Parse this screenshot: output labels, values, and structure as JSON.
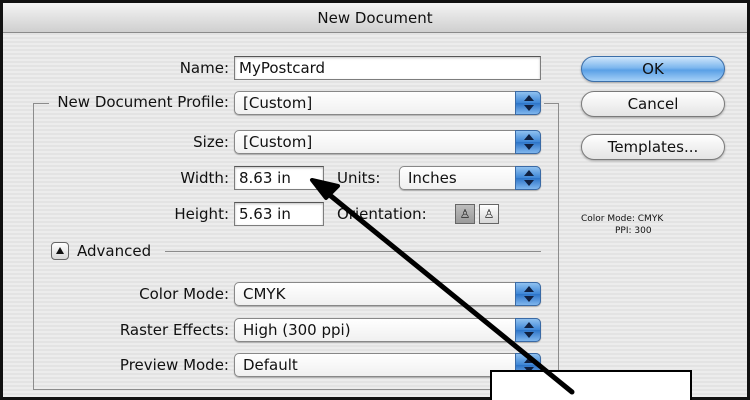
{
  "window": {
    "title": "New Document"
  },
  "form": {
    "name_label": "Name:",
    "name_value": "MyPostcard",
    "profile_label": "New Document Profile:",
    "profile_value": "[Custom]",
    "size_label": "Size:",
    "size_value": "[Custom]",
    "width_label": "Width:",
    "width_value": "8.63 in",
    "units_label": "Units:",
    "units_value": "Inches",
    "height_label": "Height:",
    "height_value": "5.63 in",
    "orientation_label": "Orientation:",
    "advanced_label": "Advanced",
    "color_mode_label": "Color Mode:",
    "color_mode_value": "CMYK",
    "raster_label": "Raster Effects:",
    "raster_value": "High (300 ppi)",
    "preview_label": "Preview Mode:",
    "preview_value": "Default"
  },
  "buttons": {
    "ok": "OK",
    "cancel": "Cancel",
    "templates": "Templates..."
  },
  "info": {
    "color_mode": "Color Mode: CMYK",
    "ppi": "PPI: 300"
  },
  "icons": {
    "select_arrow": "up-down-arrows-icon",
    "portrait": "portrait-orientation-icon",
    "landscape": "landscape-orientation-icon",
    "disclosure": "disclosure-triangle-icon"
  }
}
